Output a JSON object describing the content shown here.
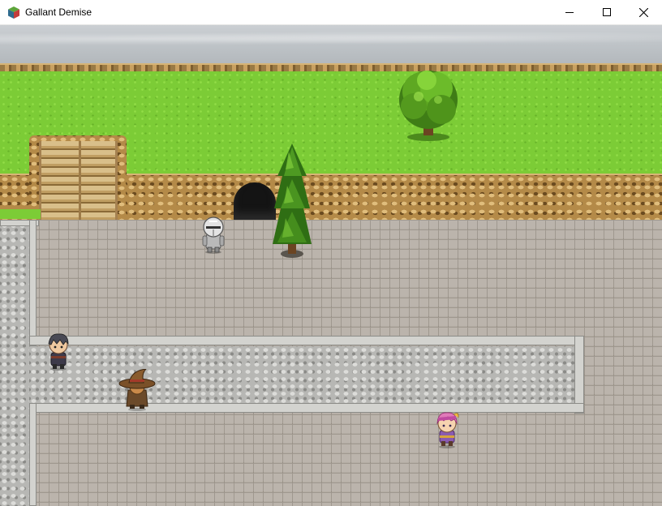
{
  "window": {
    "title": "Gallant Demise",
    "app_icon": "rpg-maker-cube-icon",
    "controls": [
      "minimize-icon",
      "maximize-icon",
      "close-icon"
    ]
  },
  "scene": {
    "type": "top-down RPG map",
    "terrain": [
      "overcast-sky",
      "grass-plateau",
      "rock-cliff",
      "stone-stairs",
      "cave-entrance",
      "brick-pavement",
      "cobblestone-path"
    ],
    "objects": [
      "round-tree",
      "tall-conifer-tree"
    ],
    "characters": [
      {
        "name": "armored-knight",
        "facing": "down"
      },
      {
        "name": "dark-haired-man",
        "facing": "down"
      },
      {
        "name": "witch-brown-hat",
        "facing": "up"
      },
      {
        "name": "pink-haired-girl",
        "facing": "down"
      }
    ]
  },
  "colors": {
    "grass": "#7ccc36",
    "cliff": "#b48a48",
    "pavement": "#b3aca3",
    "cobble": "#b7b7b4",
    "sky": "#bfc4c8"
  }
}
